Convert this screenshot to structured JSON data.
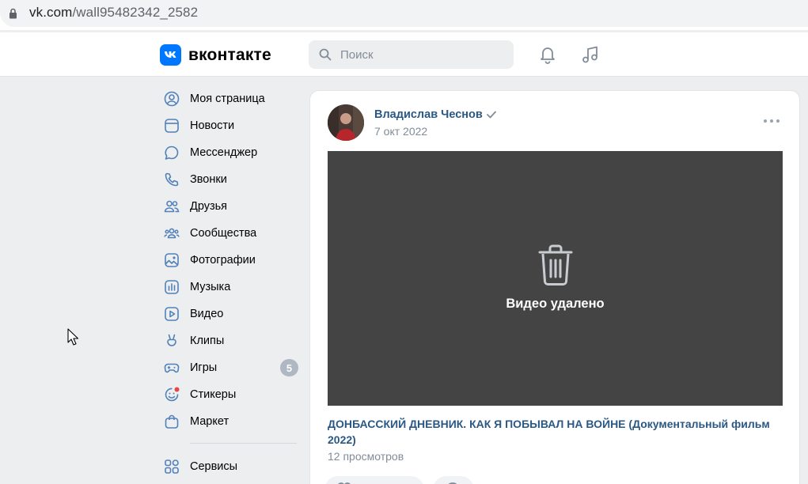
{
  "browser": {
    "url_host": "vk.com",
    "url_path": "/wall95482342_2582"
  },
  "header": {
    "logo_text": "вконтакте",
    "search_placeholder": "Поиск",
    "icons": [
      "bell-icon",
      "music-icon"
    ]
  },
  "sidebar": {
    "items": [
      {
        "label": "Моя страница",
        "icon": "user-circle-icon"
      },
      {
        "label": "Новости",
        "icon": "news-icon"
      },
      {
        "label": "Мессенджер",
        "icon": "message-icon"
      },
      {
        "label": "Звонки",
        "icon": "phone-icon"
      },
      {
        "label": "Друзья",
        "icon": "friends-icon"
      },
      {
        "label": "Сообщества",
        "icon": "communities-icon"
      },
      {
        "label": "Фотографии",
        "icon": "photos-icon"
      },
      {
        "label": "Музыка",
        "icon": "music-library-icon"
      },
      {
        "label": "Видео",
        "icon": "video-icon"
      },
      {
        "label": "Клипы",
        "icon": "clips-icon"
      },
      {
        "label": "Игры",
        "icon": "gamepad-icon",
        "badge": "5"
      },
      {
        "label": "Стикеры",
        "icon": "stickers-icon"
      },
      {
        "label": "Маркет",
        "icon": "market-bag-icon"
      }
    ],
    "services_label": "Сервисы"
  },
  "post": {
    "author": "Владислав Чеснов",
    "date": "7 окт 2022",
    "video_status": "Видео удалено",
    "title": "ДОНБАССКИЙ ДНЕВНИК. КАК Я ПОБЫВАЛ НА ВОЙНЕ (Документальный фильм 2022)",
    "views": "12 просмотров"
  },
  "colors": {
    "vk_blue": "#0077ff",
    "link": "#2a5885",
    "secondary": "#818c99",
    "icon": "#5181b8",
    "video_bg": "#444444"
  }
}
